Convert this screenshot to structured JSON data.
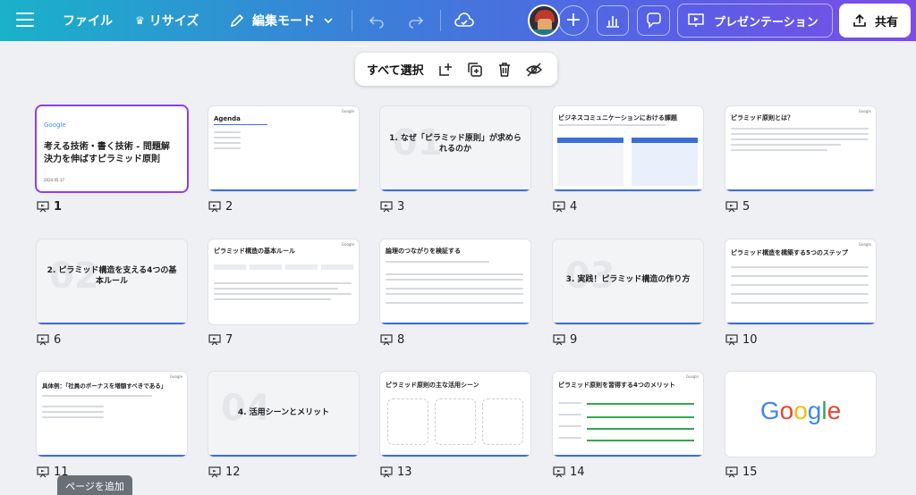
{
  "topbar": {
    "file": "ファイル",
    "resize": "リサイズ",
    "edit_mode": "編集モード",
    "present": "プレゼンテーション",
    "share": "共有"
  },
  "floating_toolbar": {
    "select_all": "すべて選択"
  },
  "slides": [
    {
      "number": "1",
      "title": "考える技術・書く技術 - 問題解決力を伸ばすピラミッド原則",
      "logo": "Google",
      "date": "2024.05.17"
    },
    {
      "number": "2",
      "title": "Agenda"
    },
    {
      "number": "3",
      "title": "1. なぜ「ピラミッド原則」が求められるのか",
      "bignum": "01"
    },
    {
      "number": "4",
      "title": "ビジネスコミュニケーションにおける課題"
    },
    {
      "number": "5",
      "title": "ピラミッド原則とは？"
    },
    {
      "number": "6",
      "title": "2. ピラミッド構造を支える4つの基本ルール",
      "bignum": "02"
    },
    {
      "number": "7",
      "title": "ピラミッド構造の基本ルール"
    },
    {
      "number": "8",
      "title": "論理のつながりを検証する"
    },
    {
      "number": "9",
      "title": "3. 実践！ピラミッド構造の作り方",
      "bignum": "03"
    },
    {
      "number": "10",
      "title": "ピラミッド構造を構築する5つのステップ"
    },
    {
      "number": "11",
      "title": "具体例：「社員のボーナスを増額すべきである」"
    },
    {
      "number": "12",
      "title": "4. 活用シーンとメリット",
      "bignum": "04"
    },
    {
      "number": "13",
      "title": "ピラミッド原則の主な活用シーン"
    },
    {
      "number": "14",
      "title": "ピラミッド原則を習得する4つのメリット"
    },
    {
      "number": "15",
      "title": "",
      "logo": "Google"
    }
  ],
  "add_page": "ページを追加",
  "colors": {
    "accent": "#8b3dff",
    "blue": "#3b6fd4",
    "green": "#34a853"
  }
}
